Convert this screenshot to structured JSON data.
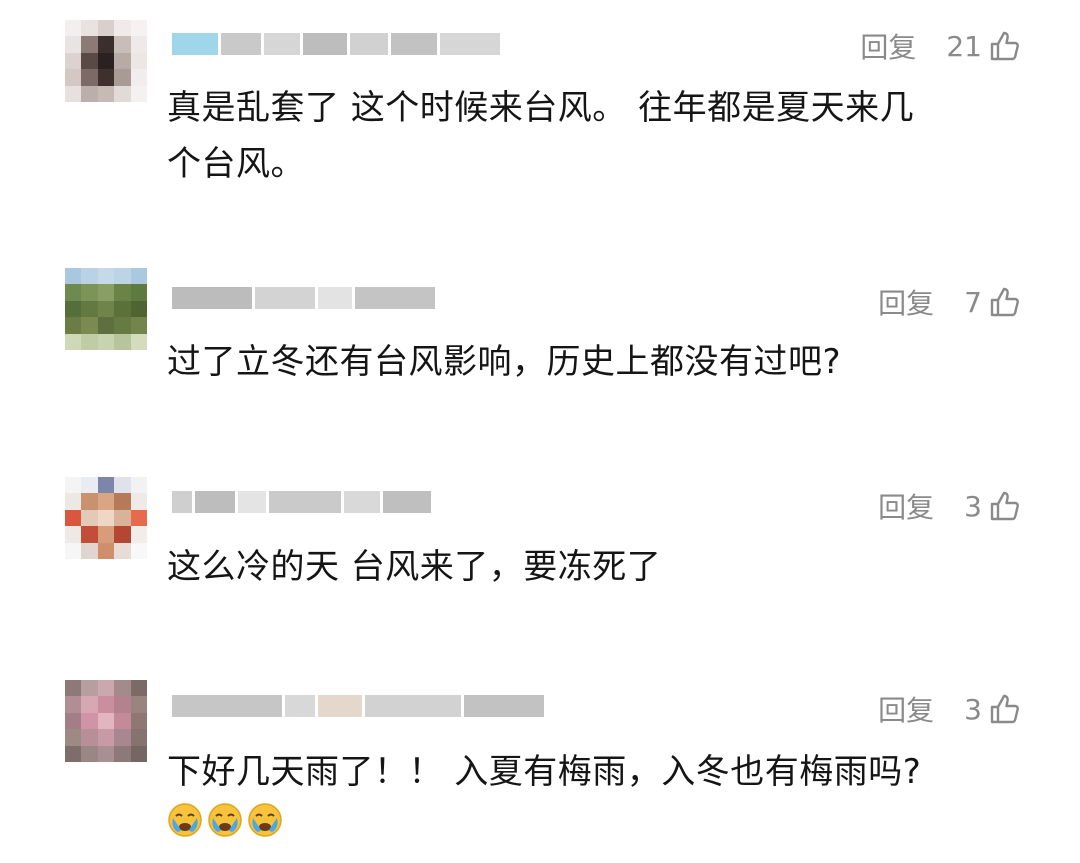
{
  "comments": [
    {
      "reply_label": "回复",
      "likes": "21",
      "text_line1": "真是乱套了 这个时候来台风。 往年都是夏天来几",
      "text_line2": "个台风。",
      "avatar_colors": [
        "#f3efef",
        "#e8e2e0",
        "#d9cfcd",
        "#f0ebea",
        "#f5f2f1",
        "#e9e3e2",
        "#8b7a76",
        "#3a2f2c",
        "#c9bdb8",
        "#efeae9",
        "#dcd3d0",
        "#5a4a46",
        "#2a2220",
        "#b8aaa5",
        "#ece6e4",
        "#d3c8c4",
        "#7b6a66",
        "#3d302d",
        "#a89a95",
        "#f1edec",
        "#e6e0de",
        "#bcaeaa",
        "#c7b9b4",
        "#e2dad7",
        "#f4f1f0"
      ]
    },
    {
      "reply_label": "回复",
      "likes": "7",
      "text_line1": "过了立冬还有台风影响，历史上都没有过吧?",
      "avatar_colors": [
        "#a9c7de",
        "#b9d2e4",
        "#c5dae8",
        "#bcd4e5",
        "#aac8df",
        "#6f8a4e",
        "#7c9458",
        "#889e63",
        "#6a8448",
        "#5f7a40",
        "#556f3a",
        "#62793f",
        "#6e8449",
        "#5a7239",
        "#4e6532",
        "#6b7d45",
        "#7a8a51",
        "#5e7040",
        "#687a44",
        "#73854c",
        "#cfd9b8",
        "#bfcca4",
        "#c9d3af",
        "#b7c49c",
        "#d4dcbd"
      ]
    },
    {
      "reply_label": "回复",
      "likes": "3",
      "text_line1": "这么冷的天 台风来了，要冻死了",
      "avatar_colors": [
        "#f4f4f4",
        "#e9ecf2",
        "#7d86a8",
        "#dfe2ea",
        "#f2f2f2",
        "#ece8e6",
        "#c8926e",
        "#d9a582",
        "#b77a58",
        "#eeeae8",
        "#d9573f",
        "#e4c9b8",
        "#f0d6c4",
        "#d8b39a",
        "#e66a4c",
        "#efe9e6",
        "#c24d38",
        "#d79d7a",
        "#b34734",
        "#f2ede9",
        "#f6f6f6",
        "#e0d6cf",
        "#cf8e6c",
        "#e7ddd6",
        "#f8f8f8"
      ]
    },
    {
      "reply_label": "回复",
      "likes": "3",
      "text_line1": "下好几天雨了！！ 入夏有梅雨，入冬也有梅雨吗?",
      "emojis": [
        "😭",
        "😭",
        "😭"
      ],
      "avatar_colors": [
        "#8d7a76",
        "#b99ea0",
        "#c9a9ad",
        "#a58a8a",
        "#7c6a66",
        "#b18d94",
        "#d7a7b4",
        "#c98f9f",
        "#b3828e",
        "#9a8480",
        "#a47e86",
        "#cf95a6",
        "#e2b5c1",
        "#c48a9a",
        "#8f7874",
        "#9d8a85",
        "#b88f98",
        "#c99aa6",
        "#a98790",
        "#857370",
        "#7e6e6a",
        "#9a8783",
        "#a78f92",
        "#8c7a77",
        "#766663"
      ]
    }
  ]
}
